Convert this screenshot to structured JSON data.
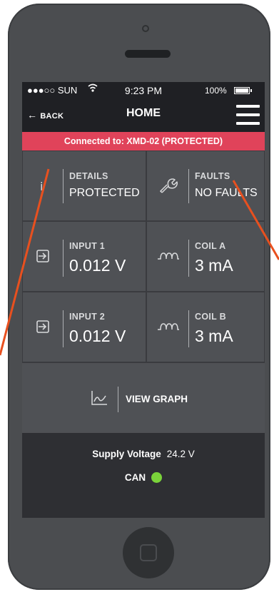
{
  "status_bar": {
    "carrier": "●●●○○ SUN",
    "wifi": "ᯤ",
    "time": "9:23 PM",
    "battery": "100%"
  },
  "nav": {
    "back_label": "BACK",
    "back_arrow": "←",
    "title": "HOME",
    "menu_icon": "hamburger-icon"
  },
  "connection_banner": "Connected to: XMD-02 (PROTECTED)",
  "tiles": {
    "details": {
      "label": "DETAILS",
      "value": "PROTECTED",
      "icon": "info-icon"
    },
    "faults": {
      "label": "FAULTS",
      "value": "NO FAULTS",
      "icon": "wrench-icon"
    },
    "input1": {
      "label": "INPUT 1",
      "value": "0.012 V",
      "icon": "input-icon"
    },
    "coilA": {
      "label": "COIL A",
      "value": "3 mA",
      "icon": "coil-icon"
    },
    "input2": {
      "label": "INPUT 2",
      "value": "0.012 V",
      "icon": "input-icon"
    },
    "coilB": {
      "label": "COIL B",
      "value": "3 mA",
      "icon": "coil-icon"
    }
  },
  "view_graph": {
    "label": "VIEW GRAPH",
    "icon": "chart-icon"
  },
  "footer": {
    "supply_label": "Supply Voltage",
    "supply_value": "24.2 V",
    "can_label": "CAN",
    "can_status_color": "#7ad33a"
  },
  "colors": {
    "banner": "#e0435a",
    "tile": "#4f5155",
    "screen_bg": "#2e2f33",
    "annotation": "#e8501f"
  }
}
